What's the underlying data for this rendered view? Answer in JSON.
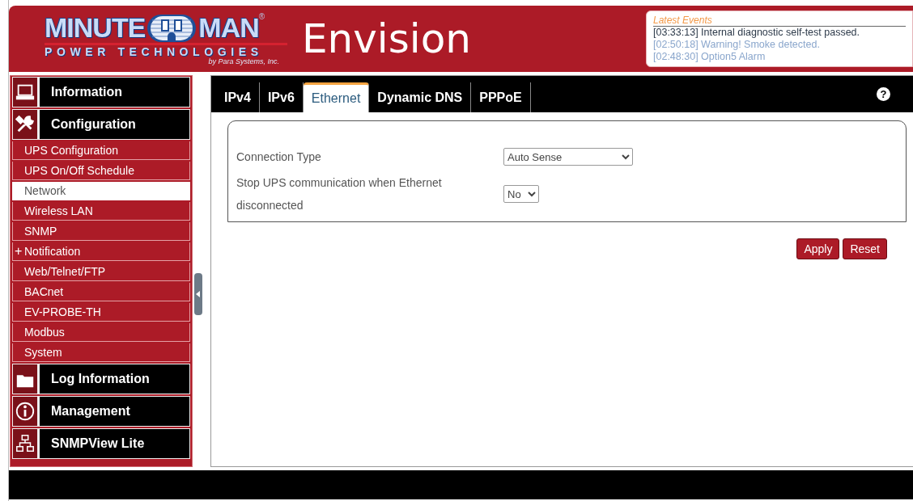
{
  "logo": {
    "word_left": "MINUTE",
    "word_right": "MAN",
    "registered": "®",
    "tagline": "POWER TECHNOLOGIES",
    "byline": "by Para Systems, Inc."
  },
  "app_title": "Envision",
  "latest_events": {
    "title": "Latest Events",
    "items": [
      {
        "time": "[03:33:13]",
        "text": "Internal diagnostic self-test passed.",
        "unread": true
      },
      {
        "time": "[02:50:18]",
        "text": "Warning! Smoke detected.",
        "unread": false
      },
      {
        "time": "[02:48:30]",
        "text": "Option5 Alarm",
        "unread": false
      }
    ]
  },
  "sidebar": {
    "items": [
      {
        "kind": "section",
        "label": "Information"
      },
      {
        "kind": "section",
        "label": "Configuration"
      },
      {
        "kind": "sub",
        "label": "UPS Configuration",
        "selected": false
      },
      {
        "kind": "sub",
        "label": "UPS On/Off Schedule",
        "selected": false
      },
      {
        "kind": "sub",
        "label": "Network",
        "selected": true
      },
      {
        "kind": "sub",
        "label": "Wireless LAN",
        "selected": false
      },
      {
        "kind": "sub",
        "label": "SNMP",
        "selected": false
      },
      {
        "kind": "sub",
        "label": "Notification",
        "prefix": "+",
        "selected": false
      },
      {
        "kind": "sub",
        "label": "Web/Telnet/FTP",
        "selected": false
      },
      {
        "kind": "sub",
        "label": "BACnet",
        "selected": false
      },
      {
        "kind": "sub",
        "label": "EV-PROBE-TH",
        "selected": false
      },
      {
        "kind": "sub",
        "label": "Modbus",
        "selected": false
      },
      {
        "kind": "sub",
        "label": "System",
        "selected": false
      },
      {
        "kind": "section",
        "label": "Log Information"
      },
      {
        "kind": "section",
        "label": "Management"
      },
      {
        "kind": "section",
        "label": "SNMPView Lite"
      }
    ]
  },
  "tabs": [
    {
      "label": "IPv4",
      "selected": false
    },
    {
      "label": "IPv6",
      "selected": false
    },
    {
      "label": "Ethernet",
      "selected": true
    },
    {
      "label": "Dynamic DNS",
      "selected": false
    },
    {
      "label": "PPPoE",
      "selected": false
    }
  ],
  "help": "?",
  "form": {
    "rows": [
      {
        "label": "Connection Type",
        "value": "Auto Sense"
      },
      {
        "label": "Stop UPS communication when Ethernet disconnected",
        "value": "No"
      }
    ]
  },
  "buttons": [
    "Apply",
    "Reset"
  ]
}
